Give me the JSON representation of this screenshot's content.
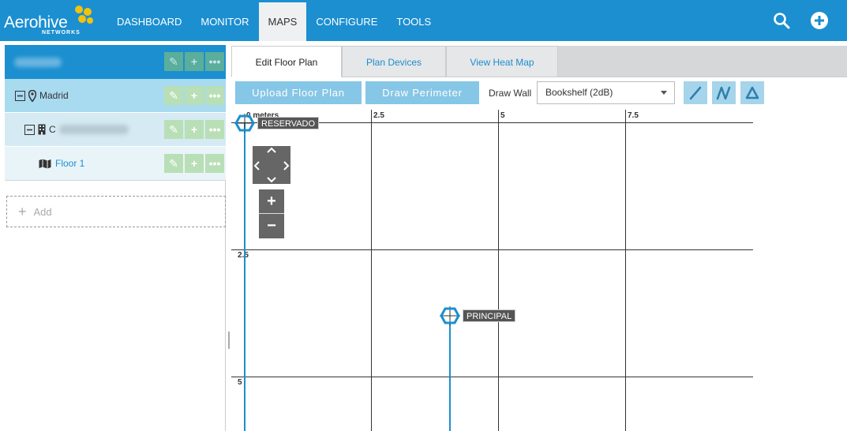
{
  "brand": {
    "name": "Aerohive",
    "sub": "NETWORKS"
  },
  "nav": {
    "items": [
      {
        "label": "DASHBOARD"
      },
      {
        "label": "MONITOR"
      },
      {
        "label": "MAPS",
        "active": true
      },
      {
        "label": "CONFIGURE"
      },
      {
        "label": "TOOLS"
      }
    ]
  },
  "tree": {
    "root_label": "",
    "madrid_label": "Madrid",
    "building_label": "C",
    "floor_label": "Floor 1",
    "add_label": "Add"
  },
  "tabs": [
    {
      "label": "Edit Floor Plan",
      "active": true
    },
    {
      "label": "Plan Devices"
    },
    {
      "label": "View Heat Map"
    }
  ],
  "toolbar": {
    "upload_label": "Upload Floor Plan",
    "perimeter_label": "Draw Perimeter",
    "draw_wall_label": "Draw Wall",
    "wall_type": "Bookshelf (2dB)"
  },
  "map": {
    "x_ticks": [
      "0 meters",
      "2.5",
      "5",
      "7.5"
    ],
    "y_ticks": [
      "2.5",
      "5"
    ],
    "devices": [
      {
        "name": "RESERVADO"
      },
      {
        "name": "PRINCIPAL"
      }
    ]
  },
  "colors": {
    "primary": "#1b8fd0",
    "accent": "#f4c20d",
    "add_green": "#b9dfb6"
  }
}
